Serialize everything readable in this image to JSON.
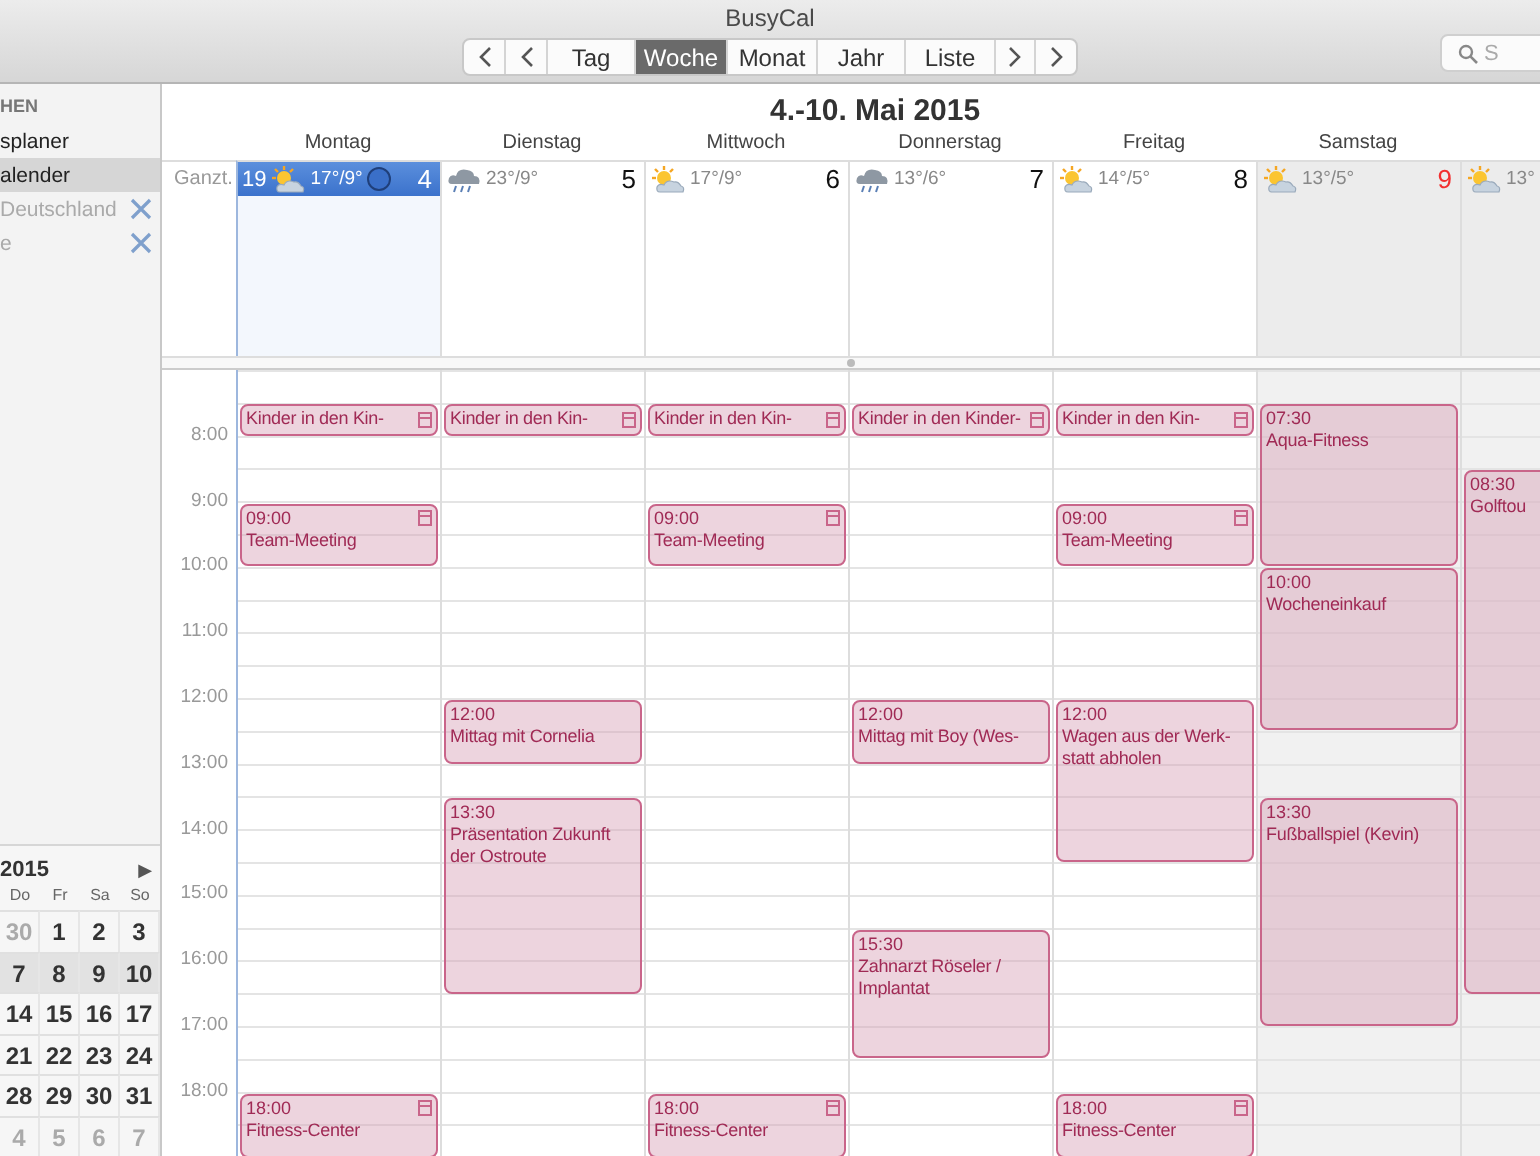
{
  "window": {
    "title": "BusyCal"
  },
  "toolbar": {
    "views": [
      {
        "label": "Tag",
        "selected": false
      },
      {
        "label": "Woche",
        "selected": true
      },
      {
        "label": "Monat",
        "selected": false
      },
      {
        "label": "Jahr",
        "selected": false
      },
      {
        "label": "Liste",
        "selected": false
      }
    ],
    "search": {
      "placeholder": "S"
    }
  },
  "sidebar": {
    "section": "HEN",
    "items": [
      {
        "label": "splaner",
        "selected": false,
        "disabled": false,
        "kind": "calendar"
      },
      {
        "label": "alender",
        "selected": true,
        "disabled": false,
        "kind": "calendar"
      },
      {
        "label": "Deutschland",
        "selected": false,
        "disabled": true,
        "kind": "subscription"
      },
      {
        "label": "e",
        "selected": false,
        "disabled": true,
        "kind": "subscription"
      }
    ]
  },
  "mini_calendar": {
    "year": "2015",
    "next": "▶",
    "weekdays": [
      "Do",
      "Fr",
      "Sa",
      "So"
    ],
    "weeks": [
      {
        "selected": false,
        "days": [
          {
            "label": "30",
            "muted": true
          },
          {
            "label": "1",
            "muted": false
          },
          {
            "label": "2",
            "muted": false
          },
          {
            "label": "3",
            "muted": false
          }
        ]
      },
      {
        "selected": true,
        "days": [
          {
            "label": "7",
            "muted": false
          },
          {
            "label": "8",
            "muted": false
          },
          {
            "label": "9",
            "muted": false
          },
          {
            "label": "10",
            "muted": false
          }
        ]
      },
      {
        "selected": false,
        "days": [
          {
            "label": "14",
            "muted": false
          },
          {
            "label": "15",
            "muted": false
          },
          {
            "label": "16",
            "muted": false
          },
          {
            "label": "17",
            "muted": false
          }
        ]
      },
      {
        "selected": false,
        "days": [
          {
            "label": "21",
            "muted": false
          },
          {
            "label": "22",
            "muted": false
          },
          {
            "label": "23",
            "muted": false
          },
          {
            "label": "24",
            "muted": false
          }
        ]
      },
      {
        "selected": false,
        "days": [
          {
            "label": "28",
            "muted": false
          },
          {
            "label": "29",
            "muted": false
          },
          {
            "label": "30",
            "muted": false
          },
          {
            "label": "31",
            "muted": false
          }
        ]
      },
      {
        "selected": false,
        "days": [
          {
            "label": "4",
            "muted": true
          },
          {
            "label": "5",
            "muted": true
          },
          {
            "label": "6",
            "muted": true
          },
          {
            "label": "7",
            "muted": true
          }
        ]
      }
    ]
  },
  "week": {
    "title": "4.-10. Mai 2015",
    "allday_label": "Ganzt.",
    "week_number": "19",
    "hours": [
      "8:00",
      "9:00",
      "10:00",
      "11:00",
      "12:00",
      "13:00",
      "14:00",
      "15:00",
      "16:00",
      "17:00",
      "18:00"
    ],
    "days": [
      {
        "name": "Montag",
        "date": "4",
        "kind": "sunny",
        "temps": "17°/9°",
        "selected": true,
        "weekend": false,
        "moon": true,
        "events": [
          {
            "title": "Kinder in den Kin-",
            "kind": "half",
            "locked": true
          },
          {
            "time": "09:00",
            "title": "Team-Meeting",
            "kind": "one",
            "locked": true
          },
          {
            "time": "18:00",
            "title": "Fitness-Center",
            "kind": "one",
            "locked": true
          }
        ]
      },
      {
        "name": "Dienstag",
        "date": "5",
        "kind": "rainy",
        "temps": "23°/9°",
        "selected": false,
        "weekend": false,
        "moon": false,
        "events": [
          {
            "title": "Kinder in den Kin-",
            "kind": "half",
            "locked": true
          },
          {
            "time": "12:00",
            "title": "Mittag mit Cornelia",
            "kind": "one",
            "locked": false
          },
          {
            "time": "13:30",
            "title": "Präsentation Zukunft der Ostroute",
            "kind": "three",
            "locked": false
          }
        ]
      },
      {
        "name": "Mittwoch",
        "date": "6",
        "kind": "sunny",
        "temps": "17°/9°",
        "selected": false,
        "weekend": false,
        "moon": false,
        "events": [
          {
            "title": "Kinder in den Kin-",
            "kind": "half",
            "locked": true
          },
          {
            "time": "09:00",
            "title": "Team-Meeting",
            "kind": "one",
            "locked": true
          },
          {
            "time": "18:00",
            "title": "Fitness-Center",
            "kind": "one",
            "locked": true
          }
        ]
      },
      {
        "name": "Donnerstag",
        "date": "7",
        "kind": "rainy",
        "temps": "13°/6°",
        "selected": false,
        "weekend": false,
        "moon": false,
        "events": [
          {
            "title": "Kinder in den Kinder-",
            "kind": "half",
            "locked": true
          },
          {
            "time": "12:00",
            "title": "Mittag mit Boy (Wes-",
            "kind": "one",
            "locked": false
          },
          {
            "time": "15:30",
            "title": "Zahnarzt Röseler / Implantat",
            "kind": "two",
            "locked": false
          }
        ]
      },
      {
        "name": "Freitag",
        "date": "8",
        "kind": "sunny",
        "temps": "14°/5°",
        "selected": false,
        "weekend": false,
        "moon": false,
        "events": [
          {
            "title": "Kinder in den Kin-",
            "kind": "half",
            "locked": true
          },
          {
            "time": "09:00",
            "title": "Team-Meeting",
            "kind": "one",
            "locked": true
          },
          {
            "time": "12:00",
            "title": "Wagen aus der Werk-statt abholen",
            "kind": "two-half",
            "locked": false
          },
          {
            "time": "18:00",
            "title": "Fitness-Center",
            "kind": "one",
            "locked": true
          }
        ]
      },
      {
        "name": "Samstag",
        "date": "9",
        "kind": "sunny",
        "temps": "13°/5°",
        "selected": false,
        "weekend": true,
        "moon": false,
        "events": [
          {
            "time": "07:30",
            "title": "Aqua-Fitness",
            "kind": "two-half",
            "locked": false
          },
          {
            "time": "10:00",
            "title": "Wocheneinkauf",
            "kind": "two-half",
            "locked": false
          },
          {
            "time": "13:30",
            "title": "Fußballspiel (Kevin)",
            "kind": "three-half",
            "locked": false
          }
        ]
      },
      {
        "kind": "sunny",
        "temps": "13°",
        "selected": false,
        "weekend": true,
        "moon": false,
        "events": [
          {
            "time": "08:30",
            "title": "Golftou",
            "kind": "eight",
            "locked": false
          }
        ]
      }
    ]
  }
}
